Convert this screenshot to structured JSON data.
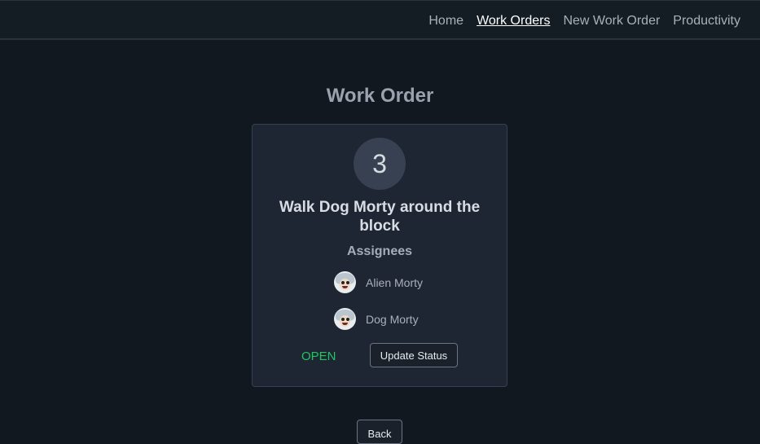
{
  "nav": {
    "items": [
      {
        "label": "Home",
        "active": false
      },
      {
        "label": "Work Orders",
        "active": true
      },
      {
        "label": "New Work Order",
        "active": false
      },
      {
        "label": "Productivity",
        "active": false
      }
    ]
  },
  "page": {
    "title": "Work Order"
  },
  "work_order": {
    "id": "3",
    "title": "Walk Dog Morty around the block",
    "assignees_heading": "Assignees",
    "assignees": [
      {
        "name": "Alien Morty",
        "avatar": "morty-avatar-icon"
      },
      {
        "name": "Dog Morty",
        "avatar": "morty-avatar-icon"
      }
    ],
    "status": "OPEN",
    "status_color": "#22c55e",
    "update_status_label": "Update Status"
  },
  "back_label": "Back",
  "colors": {
    "background": "#111820",
    "card": "#1f2633",
    "accent_open": "#22c55e"
  }
}
